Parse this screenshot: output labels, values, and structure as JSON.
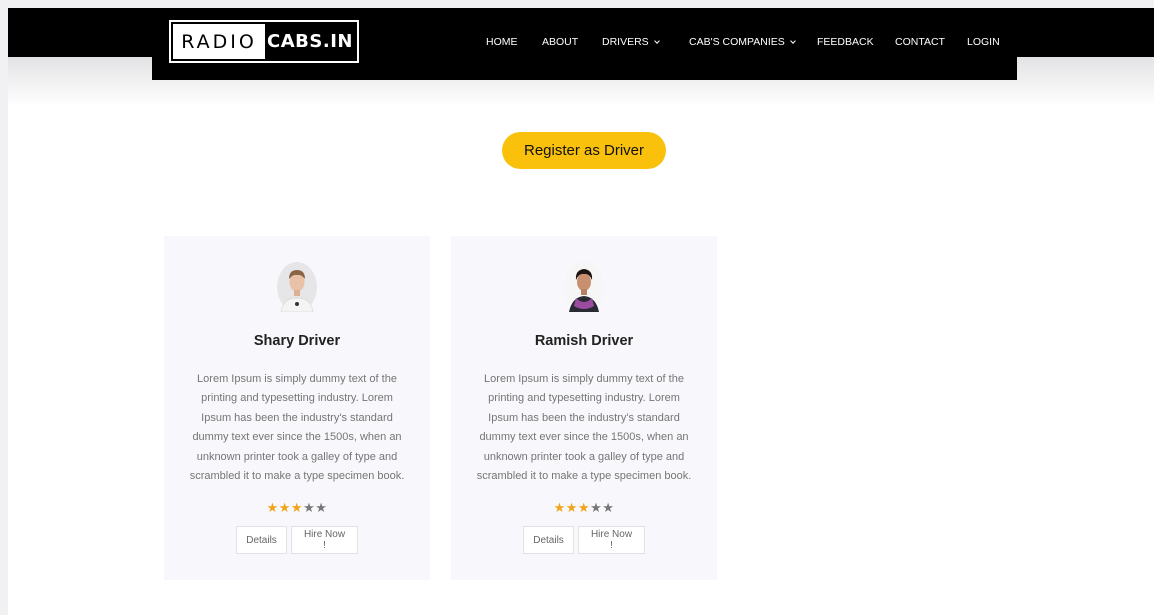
{
  "logo": {
    "left_text": "RADIO",
    "right_text": "CABS.IN"
  },
  "nav": {
    "home": "HOME",
    "about": "ABOUT",
    "drivers": "DRIVERS",
    "companies": "CAB'S COMPANIES",
    "feedback": "FEEDBACK",
    "contact": "CONTACT",
    "login": "LOGIN"
  },
  "register_label": "Register as Driver",
  "cards": [
    {
      "name": "Shary Driver",
      "desc": "Lorem Ipsum is simply dummy text of the printing and typesetting industry. Lorem Ipsum has been the industry's standard dummy text ever since the 1500s, when an unknown printer took a galley of type and scrambled it to make a type specimen book.",
      "rating": 3,
      "rating_max": 5,
      "details_label": "Details",
      "hire_label": "Hire Now !"
    },
    {
      "name": "Ramish Driver",
      "desc": "Lorem Ipsum is simply dummy text of the printing and typesetting industry. Lorem Ipsum has been the industry's standard dummy text ever since the 1500s, when an unknown printer took a galley of type and scrambled it to make a type specimen book.",
      "rating": 3,
      "rating_max": 5,
      "details_label": "Details",
      "hire_label": "Hire Now !"
    }
  ],
  "colors": {
    "accent": "#f9c10c",
    "star": "#f1a41b",
    "header": "#000000"
  }
}
